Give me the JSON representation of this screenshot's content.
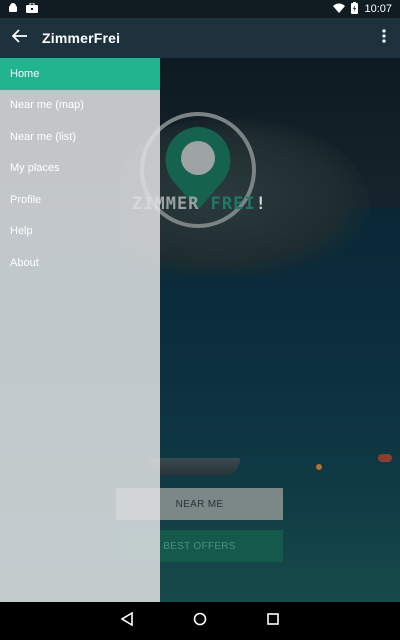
{
  "status_bar": {
    "time": "10:07",
    "icons": [
      "android-icon",
      "briefcase-icon",
      "wifi-icon",
      "battery-charging-icon"
    ]
  },
  "app_bar": {
    "title": "ZimmerFrei",
    "back_icon": "arrow-back-icon",
    "menu_icon": "more-vert-icon"
  },
  "logo": {
    "text_part1": "ZIMMER",
    "text_part2": "FREI",
    "text_part3": "!",
    "icon": "map-pin-icon"
  },
  "drawer": {
    "items": [
      {
        "label": "Home",
        "active": true
      },
      {
        "label": "Near me (map)",
        "active": false
      },
      {
        "label": "Near me (list)",
        "active": false
      },
      {
        "label": "My places",
        "active": false
      },
      {
        "label": "Profile",
        "active": false
      },
      {
        "label": "Help",
        "active": false
      },
      {
        "label": "About",
        "active": false
      }
    ]
  },
  "buttons": {
    "near_me": "NEAR ME",
    "best_offers": "BEST OFFERS"
  },
  "nav_bar": {
    "icons": [
      "back-triangle-icon",
      "home-circle-icon",
      "recents-square-icon"
    ]
  },
  "colors": {
    "accent": "#22b38f",
    "app_bar": "#1d323c",
    "status_bar": "#111c22"
  }
}
